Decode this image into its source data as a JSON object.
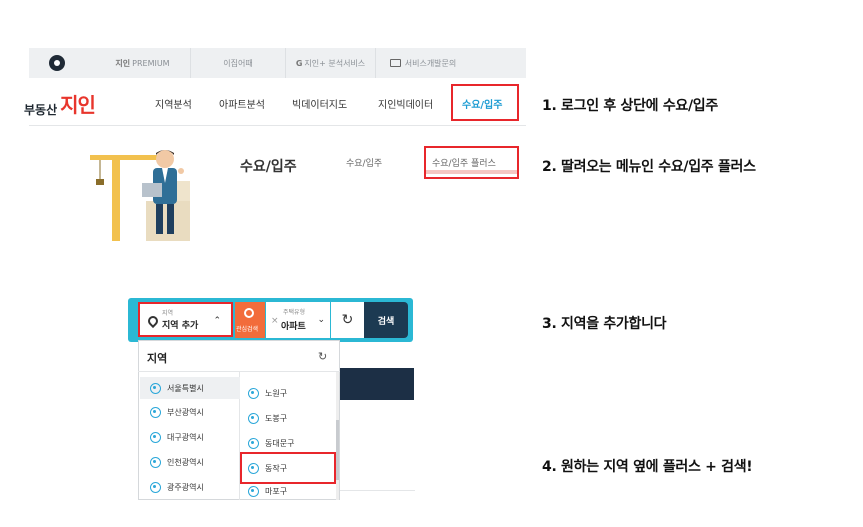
{
  "util_bar": {
    "tabs": [
      {
        "label": "PREMIUM",
        "strong": "지인"
      },
      {
        "label": "이집어때",
        "strong": ""
      },
      {
        "label": "지인+ 분석서비스",
        "strong": "G"
      },
      {
        "label": "서비스개발문의",
        "strong": ""
      }
    ]
  },
  "header": {
    "logo_small": "부동산",
    "logo_big": "지인",
    "nav": [
      "지역분석",
      "아파트분석",
      "빅데이터지도",
      "지인빅데이터",
      "수요/입주"
    ]
  },
  "submenu": {
    "title": "수요/입주",
    "links": [
      "수요/입주",
      "수요/입주 플러스"
    ]
  },
  "search": {
    "region_small": "지역",
    "region_label": "지역 추가",
    "orange_label": "관심검색",
    "type_small": "주택유형",
    "type_label": "아파트",
    "search_label": "검색"
  },
  "dropdown": {
    "header": "지역",
    "provinces": [
      "서울특별시",
      "부산광역시",
      "대구광역시",
      "인천광역시",
      "광주광역시"
    ],
    "districts": [
      "노원구",
      "도봉구",
      "동대문구",
      "동작구",
      "마포구"
    ]
  },
  "instructions": [
    "1. 로그인 후 상단에 수요/입주",
    "2. 딸려오는 메뉴인 수요/입주 플러스",
    "3. 지역을 추가합니다",
    "4. 원하는 지역 옆에 플러스 + 검색!"
  ],
  "colors": {
    "highlight": "#e8262b",
    "accent": "#1d9cd3",
    "search_bar": "#2bb8d4",
    "navy": "#1c3a52",
    "orange": "#f26c3b"
  }
}
